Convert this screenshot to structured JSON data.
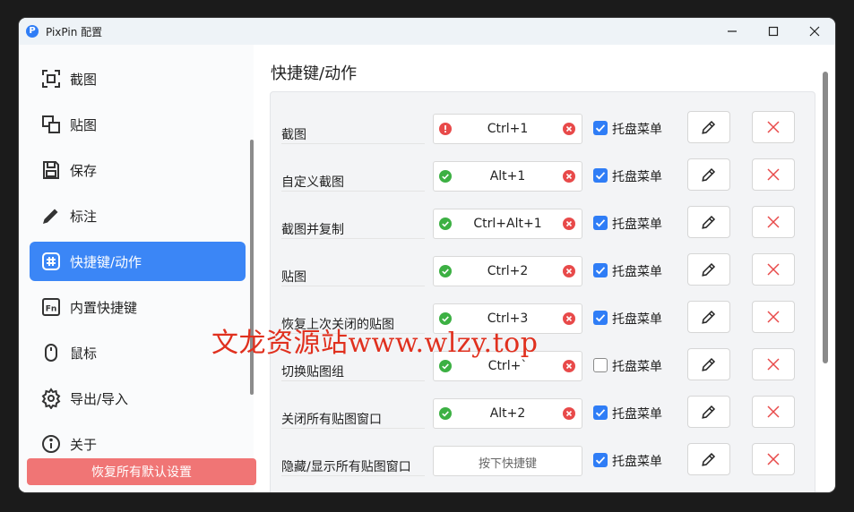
{
  "window": {
    "title": "PixPin 配置",
    "app_icon": "P"
  },
  "window_controls": {
    "minimize": "—",
    "maximize": "☐",
    "close": "✕"
  },
  "sidebar": {
    "items": [
      {
        "label": "截图",
        "icon": "screenshot-icon"
      },
      {
        "label": "贴图",
        "icon": "pin-icon"
      },
      {
        "label": "保存",
        "icon": "save-icon"
      },
      {
        "label": "标注",
        "icon": "pen-icon"
      },
      {
        "label": "快捷键/动作",
        "icon": "hashtag-icon",
        "active": true
      },
      {
        "label": "内置快捷键",
        "icon": "fn-icon"
      },
      {
        "label": "鼠标",
        "icon": "mouse-icon"
      },
      {
        "label": "导出/导入",
        "icon": "gear-icon"
      },
      {
        "label": "关于",
        "icon": "info-icon"
      }
    ],
    "reset_button": "恢复所有默认设置"
  },
  "main": {
    "title": "快捷键/动作",
    "tray_label": "托盘菜单",
    "rows": [
      {
        "label": "截图",
        "shortcut": "Ctrl+1",
        "status": "error",
        "tray": true
      },
      {
        "label": "自定义截图",
        "shortcut": "Alt+1",
        "status": "ok",
        "tray": true
      },
      {
        "label": "截图并复制",
        "shortcut": "Ctrl+Alt+1",
        "status": "ok",
        "tray": true
      },
      {
        "label": "贴图",
        "shortcut": "Ctrl+2",
        "status": "ok",
        "tray": true
      },
      {
        "label": "恢复上次关闭的贴图",
        "shortcut": "Ctrl+3",
        "status": "ok",
        "tray": true
      },
      {
        "label": "切换贴图组",
        "shortcut": "Ctrl+`",
        "status": "ok",
        "tray": false
      },
      {
        "label": "关闭所有贴图窗口",
        "shortcut": "Alt+2",
        "status": "ok",
        "tray": true
      },
      {
        "label": "隐藏/显示所有贴图窗口",
        "shortcut": "",
        "placeholder": "按下快捷键",
        "status": "none",
        "tray": true
      }
    ]
  },
  "watermark": "文龙资源站www.wlzy.top",
  "colors": {
    "accent": "#3b86f6",
    "danger": "#e84a4a",
    "success": "#3cb043",
    "reset": "#f07575"
  }
}
